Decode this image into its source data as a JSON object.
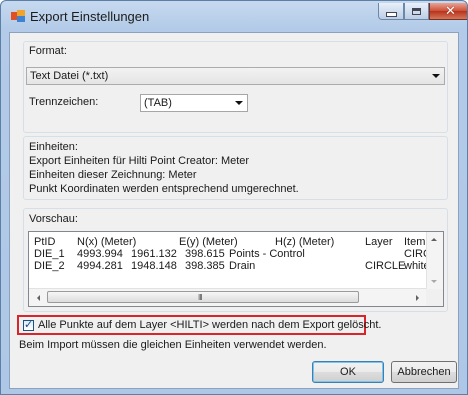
{
  "window": {
    "title": "Export Einstellungen"
  },
  "format": {
    "label": "Format:",
    "selected": "Text Datei (*.txt)"
  },
  "separator": {
    "label": "Trennzeichen:",
    "selected": "(TAB)"
  },
  "units": {
    "heading": "Einheiten:",
    "lines": [
      "Export Einheiten für Hilti Point Creator: Meter",
      "Einheiten dieser Zeichnung: Meter",
      "Punkt Koordinaten werden entsprechend umgerechnet."
    ]
  },
  "preview": {
    "heading": "Vorschau:",
    "header": [
      "PtID",
      "N(x) (Meter)",
      "E(y) (Meter)",
      "H(z) (Meter)",
      "Layer",
      "Item Nc"
    ],
    "rows": [
      [
        "DIE_1",
        "4993.994",
        "1961.132",
        "398.615",
        "Points - Control",
        "",
        "CIRCLE"
      ],
      [
        "DIE_2",
        "4994.281",
        "1948.148",
        "398.385",
        "Drain",
        "CIRCLE",
        "white"
      ]
    ],
    "scroll_grip": "III"
  },
  "delete_option": {
    "checked": true,
    "label": "Alle Punkte auf dem Layer <HILTI> werden nach dem Export gelöscht."
  },
  "import_note": "Beim Import müssen die gleichen Einheiten verwendet werden.",
  "buttons": {
    "ok": "OK",
    "cancel": "Abbrechen"
  },
  "colors": {
    "highlight": "#d9242b",
    "title_bar": "#b3cbe8",
    "close_button": "#cc5037"
  },
  "icons": {
    "app": "export-app-icon",
    "minimize": "minimize-icon",
    "maximize": "maximize-icon",
    "close": "close-icon",
    "dropdown": "chevron-down-icon",
    "check": "checkmark-icon"
  }
}
